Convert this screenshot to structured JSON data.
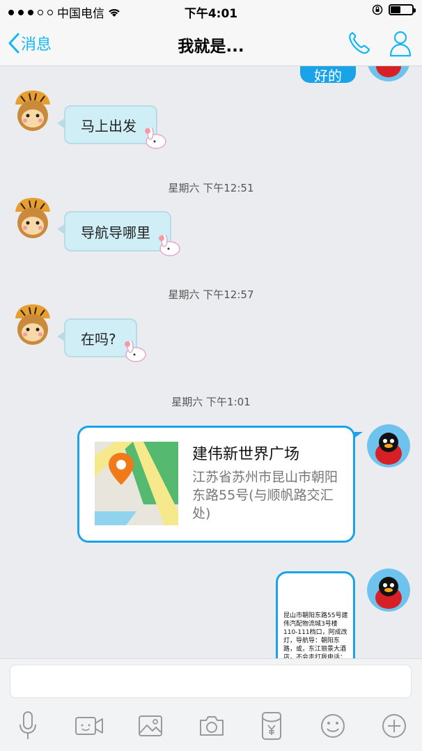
{
  "status": {
    "carrier": "中国电信",
    "time": "下午4:01"
  },
  "nav": {
    "back_label": "消息",
    "title": "我就是..."
  },
  "messages": {
    "top_partial": "好的",
    "m1": "马上出发",
    "ts1": "星期六 下午12:51",
    "m2": "导航导哪里",
    "ts2": "星期六 下午12:57",
    "m3": "在吗?",
    "ts3": "星期六 下午1:01",
    "location": {
      "name": "建伟新世界广场",
      "address": "江苏省苏州市昆山市朝阳东路55号(与顺帆路交汇处)"
    },
    "image_text": "昆山市朝阳东路55号建伟汽配物流城3号楼110-111档口，阿成改灯，导航导：朝阳东路，或，东江丽景大酒店，不会走打我电话："
  },
  "toolbar": {
    "icons": [
      "microphone-icon",
      "video-icon",
      "image-icon",
      "camera-icon",
      "red-packet-icon",
      "emoji-icon",
      "plus-icon"
    ]
  },
  "colors": {
    "accent": "#12b7f5",
    "bubble_out": "#1aa3e8",
    "bubble_in": "#cfeef6"
  }
}
